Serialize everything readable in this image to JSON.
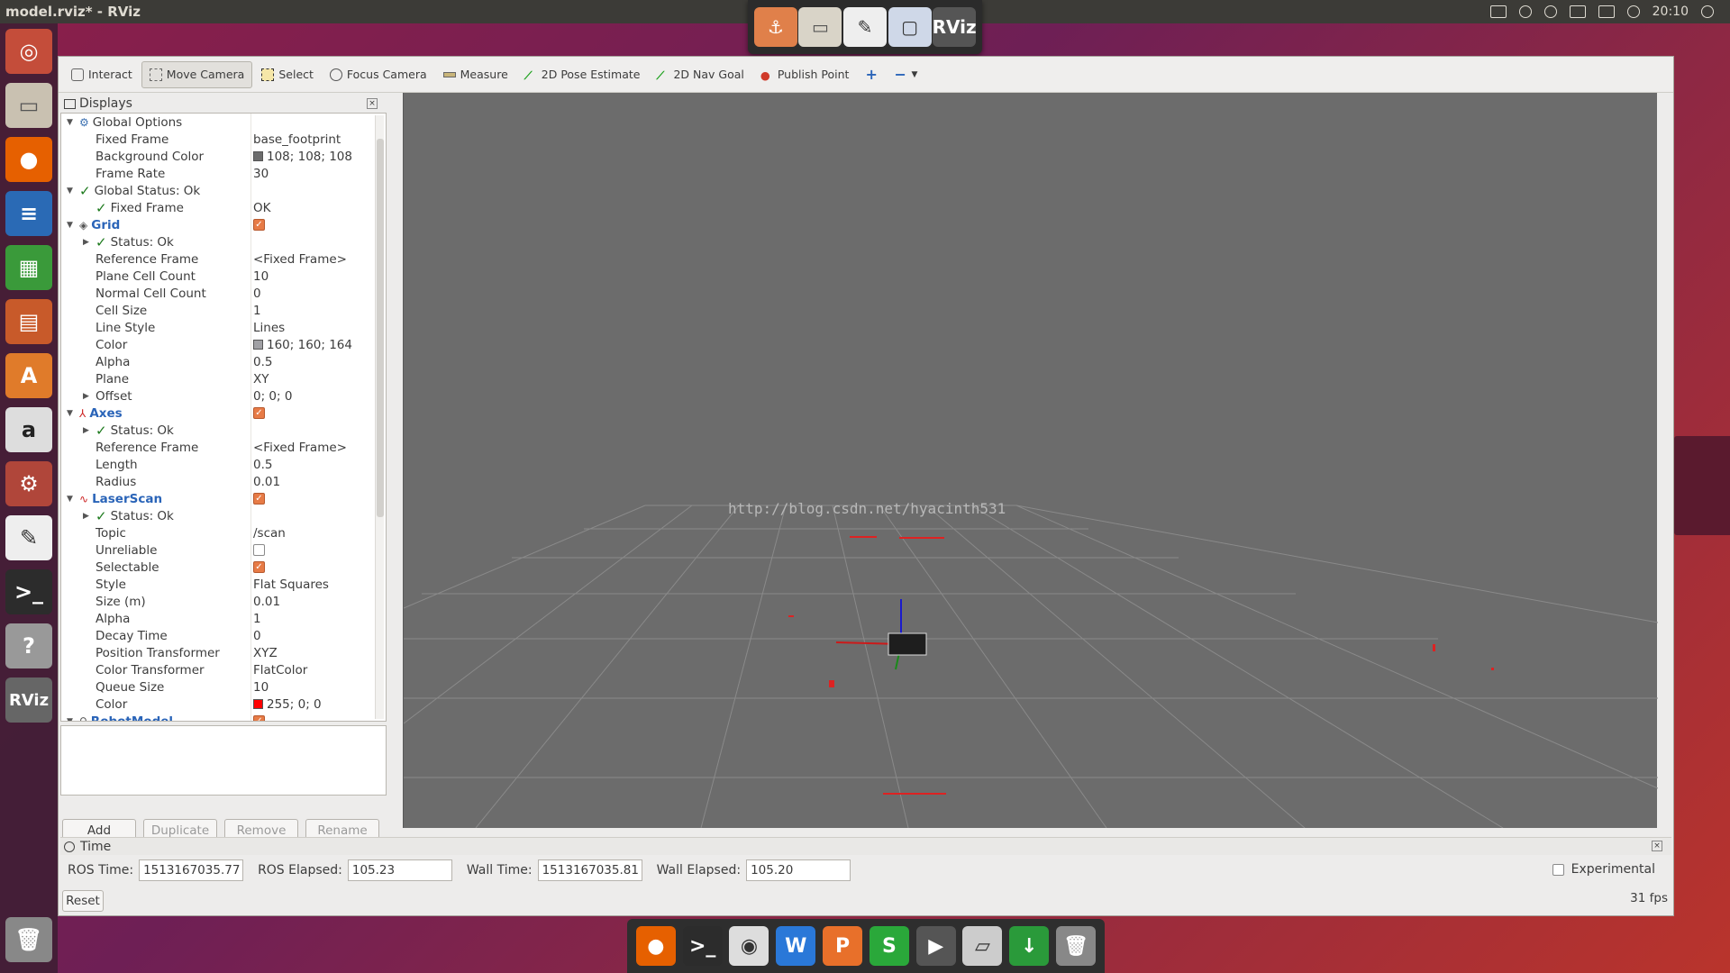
{
  "window_title": "model.rviz* - RViz",
  "clock": "20:10",
  "switcher_apps": [
    "anchor",
    "files",
    "editor",
    "window",
    "RViz"
  ],
  "launcher_apps": [
    "ubuntu-dash",
    "files",
    "firefox",
    "writer",
    "calc",
    "impress",
    "software-center",
    "amazon",
    "settings",
    "text-editor",
    "terminal",
    "help",
    "RViz"
  ],
  "toolbar": {
    "interact": "Interact",
    "move_camera": "Move Camera",
    "select": "Select",
    "focus_camera": "Focus Camera",
    "measure": "Measure",
    "pose_estimate": "2D Pose Estimate",
    "nav_goal": "2D Nav Goal",
    "publish_point": "Publish Point"
  },
  "displays": {
    "title": "Displays",
    "rows": [
      {
        "name": "Global Options",
        "value": ""
      },
      {
        "name": "Fixed Frame",
        "value": "base_footprint"
      },
      {
        "name": "Background Color",
        "value": "108; 108; 108",
        "color": "#6c6c6c"
      },
      {
        "name": "Frame Rate",
        "value": "30"
      },
      {
        "name": "Global Status: Ok",
        "value": ""
      },
      {
        "name": "Fixed Frame",
        "value": "OK"
      },
      {
        "name": "Grid",
        "value": ""
      },
      {
        "name": "Status: Ok",
        "value": ""
      },
      {
        "name": "Reference Frame",
        "value": "<Fixed Frame>"
      },
      {
        "name": "Plane Cell Count",
        "value": "10"
      },
      {
        "name": "Normal Cell Count",
        "value": "0"
      },
      {
        "name": "Cell Size",
        "value": "1"
      },
      {
        "name": "Line Style",
        "value": "Lines"
      },
      {
        "name": "Color",
        "value": "160; 160; 164",
        "color": "#a0a0a4"
      },
      {
        "name": "Alpha",
        "value": "0.5"
      },
      {
        "name": "Plane",
        "value": "XY"
      },
      {
        "name": "Offset",
        "value": "0; 0; 0"
      },
      {
        "name": "Axes",
        "value": ""
      },
      {
        "name": "Status: Ok",
        "value": ""
      },
      {
        "name": "Reference Frame",
        "value": "<Fixed Frame>"
      },
      {
        "name": "Length",
        "value": "0.5"
      },
      {
        "name": "Radius",
        "value": "0.01"
      },
      {
        "name": "LaserScan",
        "value": ""
      },
      {
        "name": "Status: Ok",
        "value": ""
      },
      {
        "name": "Topic",
        "value": "/scan"
      },
      {
        "name": "Unreliable",
        "value": ""
      },
      {
        "name": "Selectable",
        "value": ""
      },
      {
        "name": "Style",
        "value": "Flat Squares"
      },
      {
        "name": "Size (m)",
        "value": "0.01"
      },
      {
        "name": "Alpha",
        "value": "1"
      },
      {
        "name": "Decay Time",
        "value": "0"
      },
      {
        "name": "Position Transformer",
        "value": "XYZ"
      },
      {
        "name": "Color Transformer",
        "value": "FlatColor"
      },
      {
        "name": "Queue Size",
        "value": "10"
      },
      {
        "name": "Color",
        "value": "255; 0; 0",
        "color": "#ff0000"
      },
      {
        "name": "RobotModel",
        "value": ""
      }
    ]
  },
  "buttons": {
    "add": "Add",
    "duplicate": "Duplicate",
    "remove": "Remove",
    "rename": "Rename"
  },
  "watermark": "http://blog.csdn.net/hyacinth531",
  "time": {
    "title": "Time",
    "ros_time_label": "ROS Time:",
    "ros_time": "1513167035.77",
    "ros_elapsed_label": "ROS Elapsed:",
    "ros_elapsed": "105.23",
    "wall_time_label": "Wall Time:",
    "wall_time": "1513167035.81",
    "wall_elapsed_label": "Wall Elapsed:",
    "wall_elapsed": "105.20",
    "experimental": "Experimental",
    "reset": "Reset",
    "fps": "31 fps"
  },
  "dock_apps": [
    "firefox",
    "terminal",
    "media",
    "wps-writer",
    "wps-presentation",
    "wps-spreadsheet",
    "video",
    "app",
    "download",
    "trash"
  ]
}
